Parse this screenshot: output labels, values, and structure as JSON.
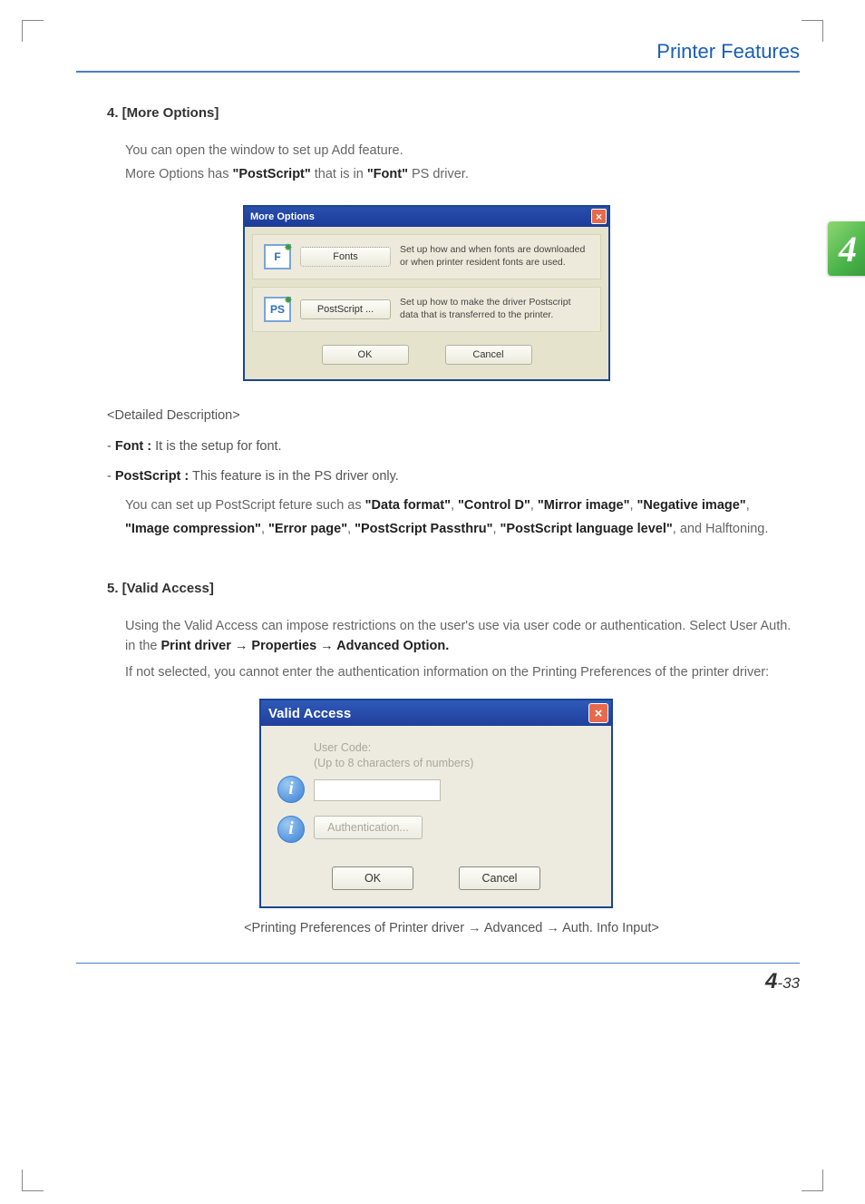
{
  "header": {
    "title": "Printer Features"
  },
  "side_tab": "4",
  "section4": {
    "heading": "4. [More Options]",
    "p1": "You can open the window to set up Add feature.",
    "p2_pre": "More Options has ",
    "p2_b1": "\"PostScript\"",
    "p2_mid": " that is in ",
    "p2_b2": "\"Font\"",
    "p2_post": " PS driver."
  },
  "dialog1": {
    "title": "More Options",
    "rows": [
      {
        "icon": "F",
        "btn": "Fonts",
        "desc": "Set up how and when fonts are downloaded or when printer resident fonts are used."
      },
      {
        "icon": "PS",
        "btn": "PostScript ...",
        "desc": "Set up how to make the driver Postscript data that is transferred to the printer."
      }
    ],
    "ok": "OK",
    "cancel": "Cancel"
  },
  "detailed": {
    "heading": "<Detailed Description>",
    "font_label": "Font :",
    "font_text": " It is the setup for font.",
    "ps_label": "PostScript :",
    "ps_text": " This feature is in the PS driver only.",
    "ps_body_pre": "You can set up PostScript feture such as ",
    "kw": [
      "\"Data format\"",
      "\"Control D\"",
      "\"Mirror image\"",
      "\"Negative image\"",
      "\"Image compression\"",
      "\"Error page\"",
      "\"PostScript Passthru\"",
      "\"PostScript language level\""
    ],
    "ps_body_post": ", and Halftoning."
  },
  "section5": {
    "heading": "5. [Valid Access]",
    "p1_pre": "Using the Valid Access can impose restrictions on the user's use via user code or authentication. Select User Auth. in the ",
    "p1_bold": "Print driver → Properties → Advanced Option.",
    "p2": "If not selected, you cannot enter the authentication information on the Printing Preferences of the printer driver:"
  },
  "dialog2": {
    "title": "Valid Access",
    "usercode_label": "User Code:",
    "usercode_hint": "(Up to 8 characters of numbers)",
    "auth_btn": "Authentication...",
    "ok": "OK",
    "cancel": "Cancel"
  },
  "caption": "<Printing Preferences of Printer driver  → Advanced → Auth. Info Input>",
  "page_number": {
    "chapter": "4",
    "sep": "-",
    "page": "33"
  }
}
